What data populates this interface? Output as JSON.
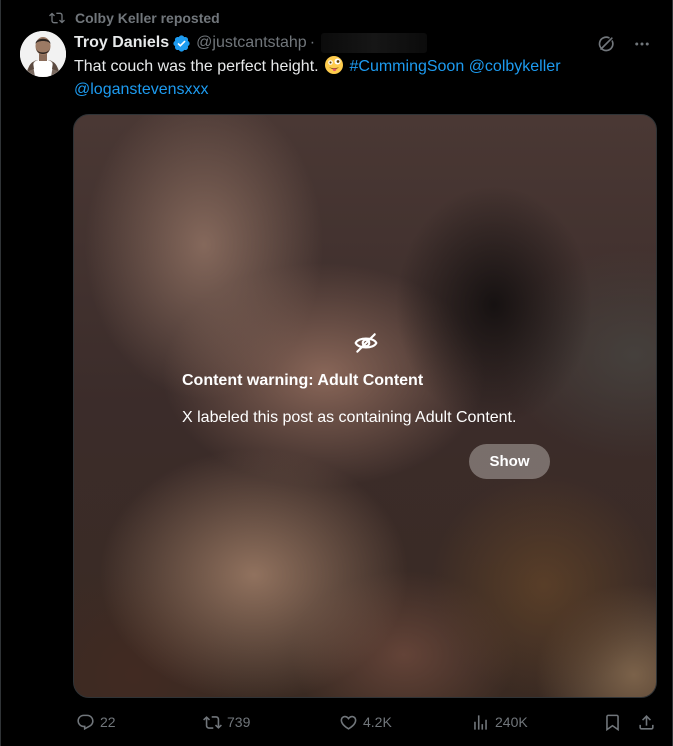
{
  "repost": {
    "text": "Colby Keller reposted",
    "icon": "repost-icon"
  },
  "author": {
    "name": "Troy Daniels",
    "verified": true,
    "handle": "@justcantstahp",
    "separator": "·"
  },
  "tweet": {
    "text_plain": "That couch was the perfect height.",
    "emoji": "zany-face-emoji",
    "hashtag": "#CummingSoon",
    "mention_1": "@colbykeller",
    "mention_2": "@loganstevensxxx"
  },
  "media_warning": {
    "icon": "eye-slash-icon",
    "title": "Content warning: Adult Content",
    "description": "X labeled this post as containing Adult Content.",
    "button": "Show"
  },
  "actions": {
    "replies": "22",
    "reposts": "739",
    "likes": "4.2K",
    "views": "240K"
  },
  "colors": {
    "background": "#000000",
    "text": "#e7e9ea",
    "muted": "#71767b",
    "link": "#1d9bf0",
    "verified": "#1d9bf0"
  }
}
